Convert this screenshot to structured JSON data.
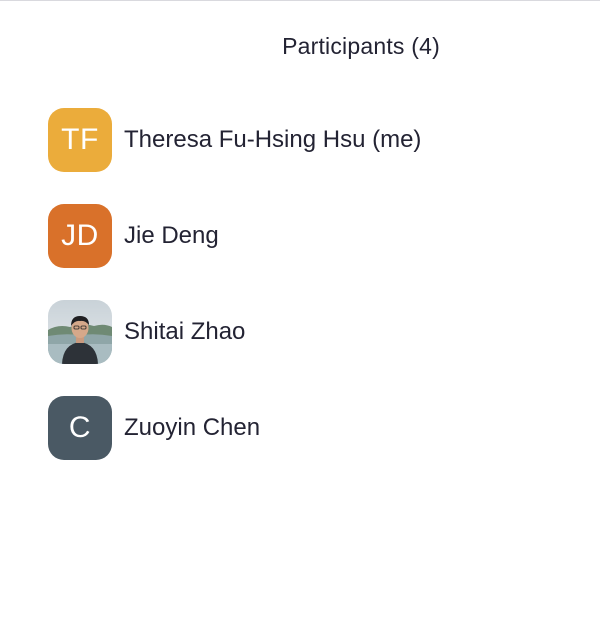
{
  "panel": {
    "title": "Participants (4)"
  },
  "participants": [
    {
      "initials": "TF",
      "name": "Theresa Fu-Hsing Hsu (me)",
      "avatar_color": "#EBAC3B",
      "avatar_type": "initials"
    },
    {
      "initials": "JD",
      "name": "Jie Deng",
      "avatar_color": "#D9712A",
      "avatar_type": "initials"
    },
    {
      "initials": "",
      "name": "Shitai Zhao",
      "avatar_color": "#8A9AA3",
      "avatar_type": "photo"
    },
    {
      "initials": "C",
      "name": "Zuoyin Chen",
      "avatar_color": "#4A5964",
      "avatar_type": "initials"
    }
  ]
}
